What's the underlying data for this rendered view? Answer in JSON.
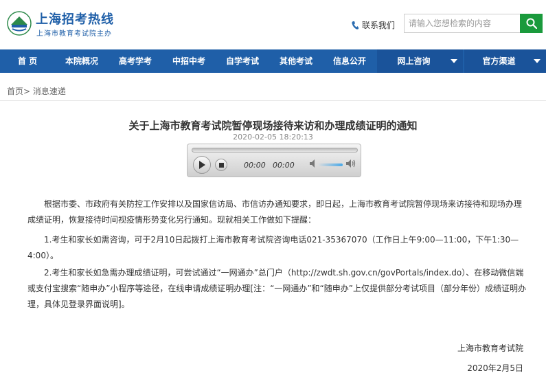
{
  "header": {
    "title": "上海招考热线",
    "subtitle": "上海市教育考试院主办",
    "logo_icon": "seal-logo-icon",
    "contact_label": "联系我们",
    "search_placeholder": "请输入您想检索的内容",
    "brand_color": "#1f5fa8",
    "search_button_color": "#1a9a3c"
  },
  "nav": {
    "items": [
      {
        "label": "首 页"
      },
      {
        "label": "本院概况"
      },
      {
        "label": "高考学考"
      },
      {
        "label": "中招中考"
      },
      {
        "label": "自学考试"
      },
      {
        "label": "其他考试"
      },
      {
        "label": "信息公开"
      }
    ],
    "dropdowns": [
      {
        "label": "网上咨询"
      },
      {
        "label": "官方渠道"
      }
    ]
  },
  "breadcrumb": {
    "home": "首页",
    "separator": ">",
    "current": "消息速递"
  },
  "article": {
    "title": "关于上海市教育考试院暂停现场接待来访和办理成绩证明的通知",
    "datetime": "2020-02-05 18:20:13",
    "player": {
      "current_time": "00:00",
      "duration": "00:00"
    },
    "paragraphs": [
      "根据市委、市政府有关防控工作安排以及国家信访局、市信访办通知要求，即日起，上海市教育考试院暂停现场来访接待和现场办理成绩证明，恢复接待时间视疫情形势变化另行通知。现就相关工作做如下提醒：",
      "1.考生和家长如需咨询，可于2月10日起拨打上海市教育考试院咨询电话021-35367070（工作日上午9:00—11:00，下午1:30—4:00）。",
      "2.考生和家长如急需办理成绩证明，可尝试通过“一网通办”总门户（http://zwdt.sh.gov.cn/govPortals/index.do）、在移动微信端或支付宝搜索“随申办”小程序等途径，在线申请成绩证明办理[注：“一网通办”和“随申办”上仅提供部分考试项目（部分年份）成绩证明办理，具体见登录界面说明]。"
    ],
    "signature": "上海市教育考试院",
    "sign_date": "2020年2月5日"
  }
}
